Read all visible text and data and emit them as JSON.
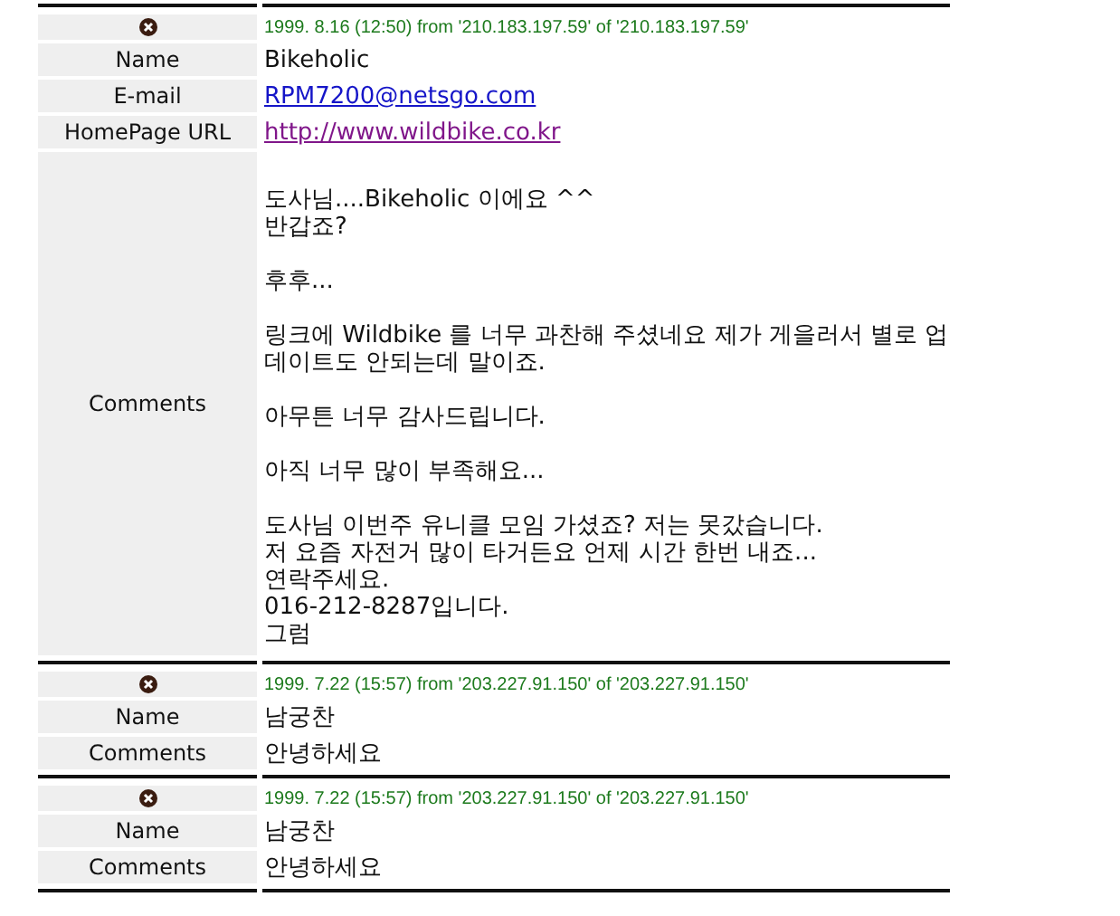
{
  "entries": [
    {
      "date_line": "1999. 8.16 (12:50) from '210.183.197.59' of '210.183.197.59'",
      "fields": [
        {
          "kind": "text",
          "label": "Name",
          "value": "Bikeholic"
        },
        {
          "kind": "link",
          "label": "E-mail",
          "value": "RPM7200@netsgo.com",
          "visited": false
        },
        {
          "kind": "link",
          "label": "HomePage URL",
          "value": "http://www.wildbike.co.kr",
          "visited": true
        },
        {
          "kind": "paragraphs",
          "label": "Comments",
          "paragraphs": [
            [
              "도사님....Bikeholic 이에요 ^^",
              "반갑죠?"
            ],
            [
              "후후..."
            ],
            [
              "링크에 Wildbike 를 너무 과찬해 주셨네요 제가 게을러서 별로 업",
              "데이트도 안되는데 말이죠."
            ],
            [
              "아무튼 너무 감사드립니다."
            ],
            [
              "아직 너무 많이 부족해요..."
            ],
            [
              "도사님 이번주 유니클 모임 가셨죠? 저는 못갔습니다.",
              "저 요즘 자전거 많이 타거든요 언제 시간 한번 내죠...",
              "연락주세요.",
              "016-212-8287입니다.",
              "그럼"
            ]
          ]
        }
      ]
    },
    {
      "date_line": "1999. 7.22 (15:57) from '203.227.91.150' of '203.227.91.150'",
      "fields": [
        {
          "kind": "text",
          "label": "Name",
          "value": "남궁찬"
        },
        {
          "kind": "text",
          "label": "Comments",
          "value": "안녕하세요"
        }
      ]
    },
    {
      "date_line": "1999. 7.22 (15:57) from '203.227.91.150' of '203.227.91.150'",
      "fields": [
        {
          "kind": "text",
          "label": "Name",
          "value": "남궁찬"
        },
        {
          "kind": "text",
          "label": "Comments",
          "value": "안녕하세요"
        }
      ]
    }
  ]
}
